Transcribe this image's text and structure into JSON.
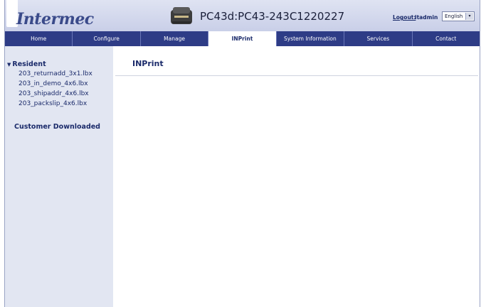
{
  "header": {
    "logo_text": "Intermec",
    "title": "PC43d:PC43-243C1220227",
    "logout_label": "Logout:",
    "user": "itadmin",
    "language": "English"
  },
  "nav": {
    "items": [
      {
        "label": "Home"
      },
      {
        "label": "Configure"
      },
      {
        "label": "Manage"
      },
      {
        "label": "INPrint",
        "active": true
      },
      {
        "label": "System Information"
      },
      {
        "label": "Services"
      },
      {
        "label": "Contact"
      }
    ]
  },
  "sidebar": {
    "resident_heading": "Resident",
    "files": [
      "203_returnadd_3x1.lbx",
      "203_in_demo_4x6.lbx",
      "203_shipaddr_4x6.lbx",
      "203_packslip_4x6.lbx"
    ],
    "downloaded_heading": "Customer Downloaded"
  },
  "main": {
    "title": "INPrint"
  }
}
